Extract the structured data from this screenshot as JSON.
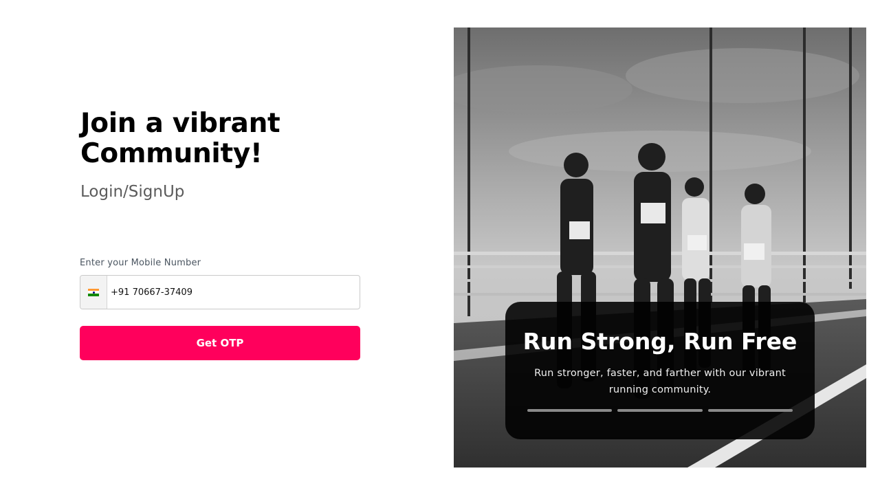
{
  "login": {
    "heading": "Join a vibrant Community!",
    "subheading": "Login/SignUp",
    "phone_label": "Enter your Mobile Number",
    "country_flag": "india-flag",
    "phone_value": "+91 70667-37409",
    "otp_button": "Get OTP"
  },
  "hero": {
    "image": "black-and-white photo of runners on a bridge",
    "card_title": "Run Strong, Run Free",
    "card_text": "Run stronger, faster, and farther with our vibrant running community.",
    "slides": 3
  },
  "colors": {
    "accent": "#ff005c",
    "card_bg": "#000000",
    "text_muted": "#5b5b5b"
  }
}
